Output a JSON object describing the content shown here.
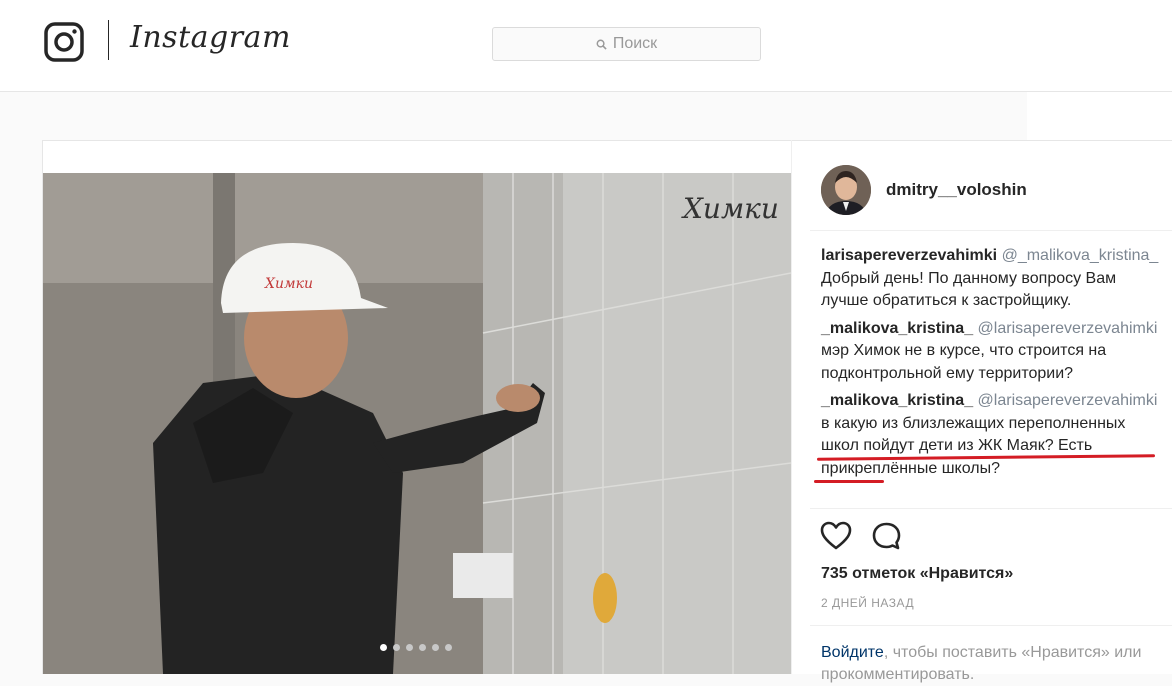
{
  "header": {
    "logo_icon": "instagram-camera-icon",
    "wordmark": "Instagram",
    "search": {
      "icon": "search-icon",
      "placeholder": "Поиск"
    }
  },
  "post": {
    "photo_watermark": "Химки",
    "carousel": {
      "count": 6,
      "active_index": 0
    },
    "author": {
      "username": "dmitry__voloshin",
      "avatar_icon": "avatar-icon"
    },
    "comments": [
      {
        "author": "larisapereverzevahimki",
        "mention": "@_malikova_kristina_",
        "text": " Добрый день! По данному вопросу Вам лучше обратиться к застройщику."
      },
      {
        "author": "_malikova_kristina_",
        "mention": "@larisapereverzevahimki",
        "text": " мэр Химок не в курсе, что строится на подконтрольной ему территории?"
      },
      {
        "author": "_malikova_kristina_",
        "mention": "@larisapereverzevahimki",
        "text": " в какую из близлежащих переполненных школ пойдут дети из ЖК Маяк? Есть прикреплённые школы?"
      }
    ],
    "actions": {
      "like_icon": "heart-icon",
      "comment_icon": "comment-bubble-icon"
    },
    "likes_text": "735 отметок «Нравится»",
    "timestamp": "2 ДНЕЙ НАЗАД",
    "login_prompt": {
      "link": "Войдите",
      "text": ", чтобы поставить «Нравится» или прокомментировать."
    }
  },
  "colors": {
    "accent_red": "#d41c24",
    "link": "#003569",
    "muted": "#999999"
  }
}
